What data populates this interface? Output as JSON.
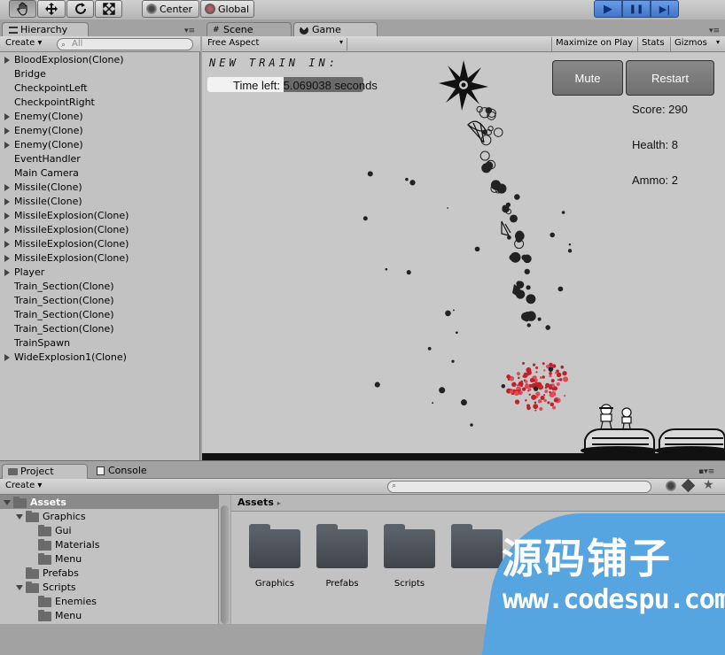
{
  "toolbar": {
    "tools": [
      "hand-tool-icon",
      "move-tool-icon",
      "rotate-tool-icon",
      "scale-tool-icon"
    ],
    "pivot_label": "Center",
    "space_label": "Global",
    "play_icon": "▶",
    "pause_icon": "❚❚",
    "step_icon": "▶|"
  },
  "hierarchy": {
    "tab_label": "Hierarchy",
    "create_label": "Create ▾",
    "search_placeholder": "All",
    "items": [
      {
        "label": "BloodExplosion(Clone)",
        "expandable": true
      },
      {
        "label": "Bridge",
        "expandable": false
      },
      {
        "label": "CheckpointLeft",
        "expandable": false
      },
      {
        "label": "CheckpointRight",
        "expandable": false
      },
      {
        "label": "Enemy(Clone)",
        "expandable": true
      },
      {
        "label": "Enemy(Clone)",
        "expandable": true
      },
      {
        "label": "Enemy(Clone)",
        "expandable": true
      },
      {
        "label": "EventHandler",
        "expandable": false
      },
      {
        "label": "Main Camera",
        "expandable": false
      },
      {
        "label": "Missile(Clone)",
        "expandable": true
      },
      {
        "label": "Missile(Clone)",
        "expandable": true
      },
      {
        "label": "MissileExplosion(Clone)",
        "expandable": true
      },
      {
        "label": "MissileExplosion(Clone)",
        "expandable": true
      },
      {
        "label": "MissileExplosion(Clone)",
        "expandable": true
      },
      {
        "label": "MissileExplosion(Clone)",
        "expandable": true
      },
      {
        "label": "Player",
        "expandable": true
      },
      {
        "label": "Train_Section(Clone)",
        "expandable": false
      },
      {
        "label": "Train_Section(Clone)",
        "expandable": false
      },
      {
        "label": "Train_Section(Clone)",
        "expandable": false
      },
      {
        "label": "Train_Section(Clone)",
        "expandable": false
      },
      {
        "label": "TrainSpawn",
        "expandable": false
      },
      {
        "label": "WideExplosion1(Clone)",
        "expandable": true
      }
    ]
  },
  "scene_tab": {
    "label": "Scene"
  },
  "game_tab": {
    "label": "Game",
    "aspect_label": "Free Aspect",
    "maximize_label": "Maximize on Play",
    "stats_label": "Stats",
    "gizmos_label": "Gizmos"
  },
  "game": {
    "banner": "NEW TRAIN IN:",
    "time_left_label": "Time left:",
    "time_left_value": "5.069038 seconds",
    "mute_label": "Mute",
    "restart_label": "Restart",
    "score_text": "Score: 290",
    "health_text": "Health: 8",
    "ammo_text": "Ammo: 2"
  },
  "project": {
    "tab_label": "Project",
    "console_label": "Console",
    "create_label": "Create ▾",
    "breadcrumb": "Assets",
    "tree": [
      {
        "label": "Assets",
        "depth": 0,
        "expanded": true,
        "selected": true
      },
      {
        "label": "Graphics",
        "depth": 1,
        "expanded": true,
        "selected": false
      },
      {
        "label": "Gui",
        "depth": 2,
        "expanded": false,
        "selected": false
      },
      {
        "label": "Materials",
        "depth": 2,
        "expanded": false,
        "selected": false
      },
      {
        "label": "Menu",
        "depth": 2,
        "expanded": false,
        "selected": false
      },
      {
        "label": "Prefabs",
        "depth": 1,
        "expanded": false,
        "selected": false
      },
      {
        "label": "Scripts",
        "depth": 1,
        "expanded": true,
        "selected": false
      },
      {
        "label": "Enemies",
        "depth": 2,
        "expanded": false,
        "selected": false
      },
      {
        "label": "Menu",
        "depth": 2,
        "expanded": false,
        "selected": false
      }
    ],
    "folders": [
      "Graphics",
      "Prefabs",
      "Scripts"
    ]
  },
  "watermark": {
    "title": "源码铺子",
    "url": "www.codespu.com"
  }
}
